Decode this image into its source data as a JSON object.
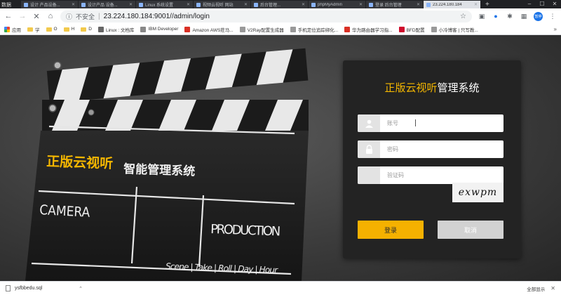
{
  "browser": {
    "first_tab_label": "数据",
    "tabs": [
      {
        "label": "设计 产品设备..."
      },
      {
        "label": "设计产品 设备..."
      },
      {
        "label": "Linux 系统设置"
      },
      {
        "label": "视频云视听 网站"
      },
      {
        "label": "后台管理..."
      },
      {
        "label": "phpMyAdmin"
      },
      {
        "label": "登录 后台管理"
      },
      {
        "label": "23.224.180.184",
        "active": true
      }
    ],
    "new_tab": "+",
    "url_security": "不安全",
    "url": "23.224.180.184:9001//admin/login",
    "avatar_text": "暂停",
    "bookmarks": [
      {
        "label": "应用",
        "kind": "apps"
      },
      {
        "label": "学",
        "kind": "folder"
      },
      {
        "label": "O",
        "kind": "folder"
      },
      {
        "label": "H",
        "kind": "folder"
      },
      {
        "label": "D",
        "kind": "folder"
      },
      {
        "label": "Linux : 文档库",
        "kind": "site",
        "color": "#666666"
      },
      {
        "label": "IBM Developer",
        "kind": "site",
        "color": "#888888"
      },
      {
        "label": "Amazon AWS莊马...",
        "kind": "site",
        "color": "#d93025"
      },
      {
        "label": "V2Ray配置生成器",
        "kind": "site",
        "color": "#999999"
      },
      {
        "label": "手机定位追踪绑化...",
        "kind": "site",
        "color": "#999999"
      },
      {
        "label": "华为路由器学习指...",
        "kind": "site",
        "color": "#d93025"
      },
      {
        "label": "BFD配置",
        "kind": "site",
        "color": "#cf0a2c"
      },
      {
        "label": "小冷博客 | 只写教...",
        "kind": "site",
        "color": "#999999"
      }
    ]
  },
  "clapper": {
    "title_highlight": "正版云视听",
    "title_rest": "智能管理系统",
    "camera": "CAMERA",
    "production": "PRODUCTION",
    "footer": "Scene | Take | Roll | Day | Hour"
  },
  "login": {
    "title_highlight": "正版云视听",
    "title_rest": "管理系统",
    "username_placeholder": "账号",
    "password_placeholder": "密码",
    "captcha_placeholder": "验证码",
    "captcha_text": "exwpm",
    "login_button": "登录",
    "cancel_button": "取消"
  },
  "download": {
    "filename": "ysfbbedu.sql",
    "show_all": "全部显示"
  },
  "colors": {
    "accent": "#f5b700",
    "panel": "#232323",
    "cancel": "#d2d2d2"
  }
}
